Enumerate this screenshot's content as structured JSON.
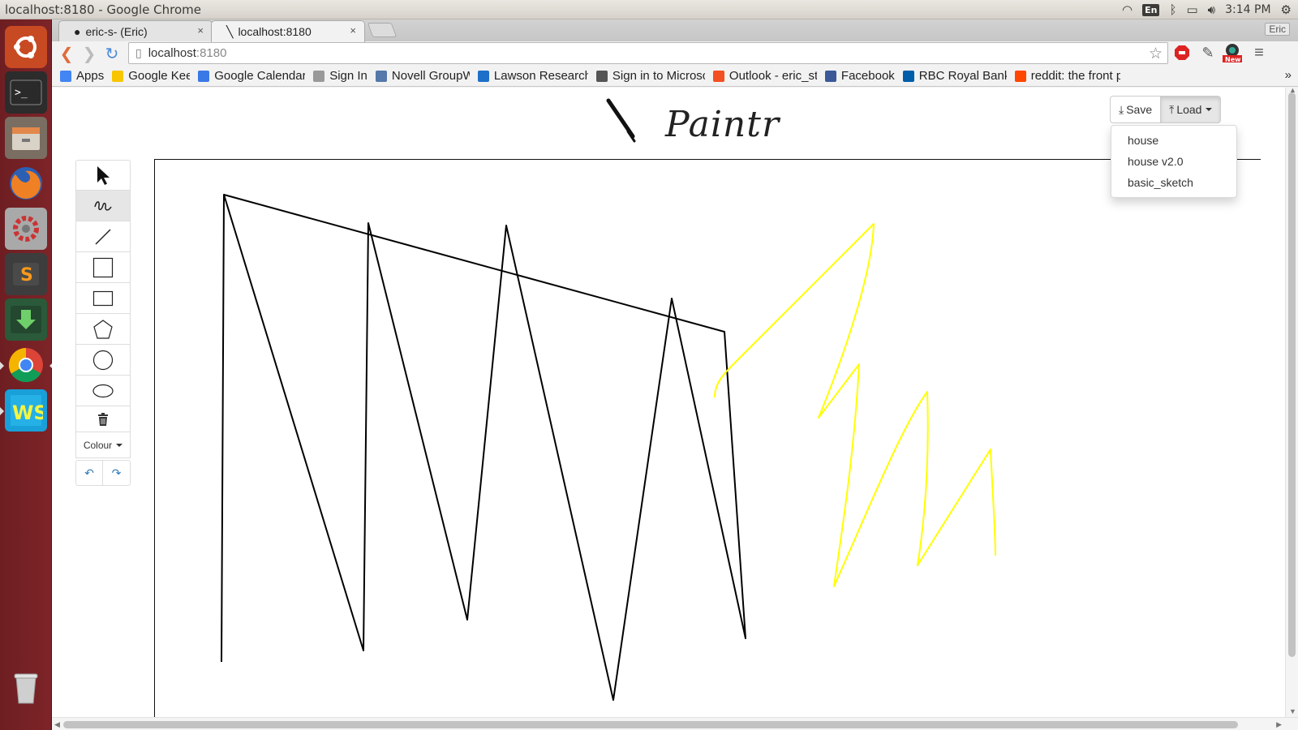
{
  "os": {
    "window_title": "localhost:8180 - Google Chrome",
    "lang": "En",
    "time": "3:14 PM"
  },
  "browser": {
    "tabs": [
      {
        "label": "eric-s- (Eric)",
        "close": "×"
      },
      {
        "label": "localhost:8180",
        "close": "×"
      }
    ],
    "user": "Eric",
    "url_host": "localhost",
    "url_port": ":8180",
    "ext_badge": "New",
    "bookmarks": [
      {
        "label": "Apps",
        "color": "#4285f4"
      },
      {
        "label": "Google Keep",
        "color": "#f7c600"
      },
      {
        "label": "Google Calendar",
        "color": "#3b78e7"
      },
      {
        "label": "Sign In",
        "color": "#999999"
      },
      {
        "label": "Novell GroupWis",
        "color": "#5577aa"
      },
      {
        "label": "Lawson Research",
        "color": "#1e6fc8"
      },
      {
        "label": "Sign in to Microsc",
        "color": "#555555"
      },
      {
        "label": "Outlook - eric_ste",
        "color": "#f25022"
      },
      {
        "label": "Facebook",
        "color": "#3b5998"
      },
      {
        "label": "RBC Royal Bank -",
        "color": "#005daa"
      },
      {
        "label": "reddit: the front p",
        "color": "#ff4500"
      }
    ],
    "bookmarks_more": "»"
  },
  "app": {
    "title": "Paintr",
    "save_label": "Save",
    "load_label": "Load",
    "load_menu": [
      "house",
      "house v2.0",
      "basic_sketch"
    ],
    "colour_label": "Colour",
    "undo": "↶",
    "redo": "↷",
    "tools": [
      "pointer",
      "freehand",
      "line",
      "square",
      "rectangle",
      "polygon",
      "circle",
      "ellipse",
      "trash"
    ],
    "selected_tool": "freehand",
    "stroke_colors": {
      "black": "#000000",
      "yellow": "#ffff00"
    }
  }
}
